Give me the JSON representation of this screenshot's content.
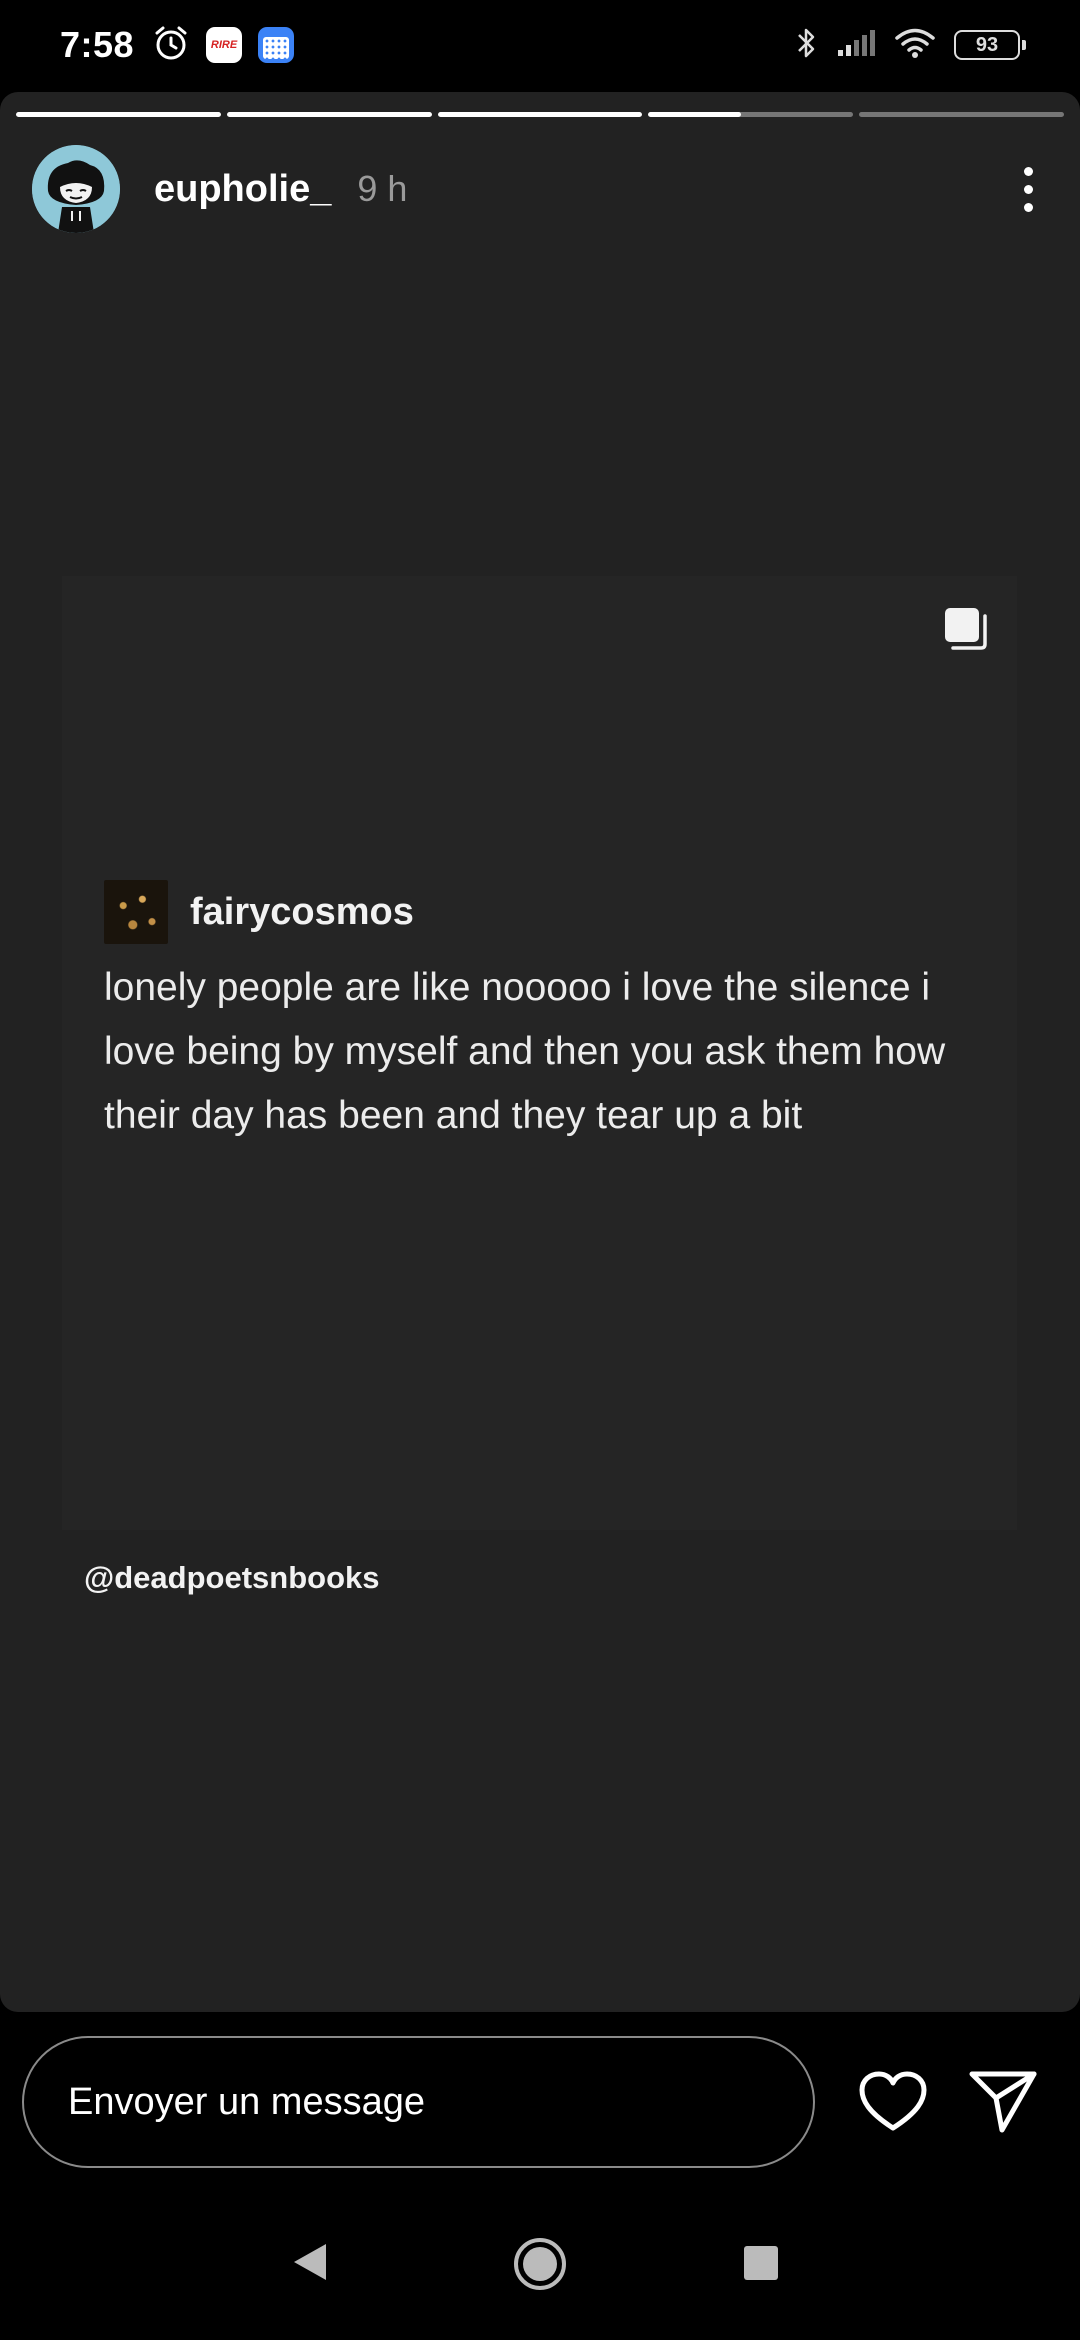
{
  "status_bar": {
    "time": "7:58",
    "left_icons": [
      "alarm-icon",
      "rire-app-icon",
      "calendar-app-icon"
    ],
    "rire_badge_text": "RIRE",
    "right_icons": [
      "bluetooth-icon",
      "signal-icon",
      "wifi-icon",
      "battery-icon"
    ],
    "battery_level": "93"
  },
  "story": {
    "progress_segments": [
      1,
      1,
      1,
      0.45,
      0
    ],
    "username": "eupholie_",
    "timestamp": "9 h",
    "background_color": "#222222",
    "post": {
      "author": "fairycosmos",
      "text": "lonely people are like nooooo i love the silence i love being by myself and then you ask them how their day has been and they tear up a bit"
    },
    "mention": "@deadpoetsnbooks"
  },
  "reply_bar": {
    "placeholder": "Envoyer un message"
  },
  "nav_bar": {
    "icons": [
      "back-icon",
      "home-icon",
      "recent-apps-icon"
    ]
  }
}
